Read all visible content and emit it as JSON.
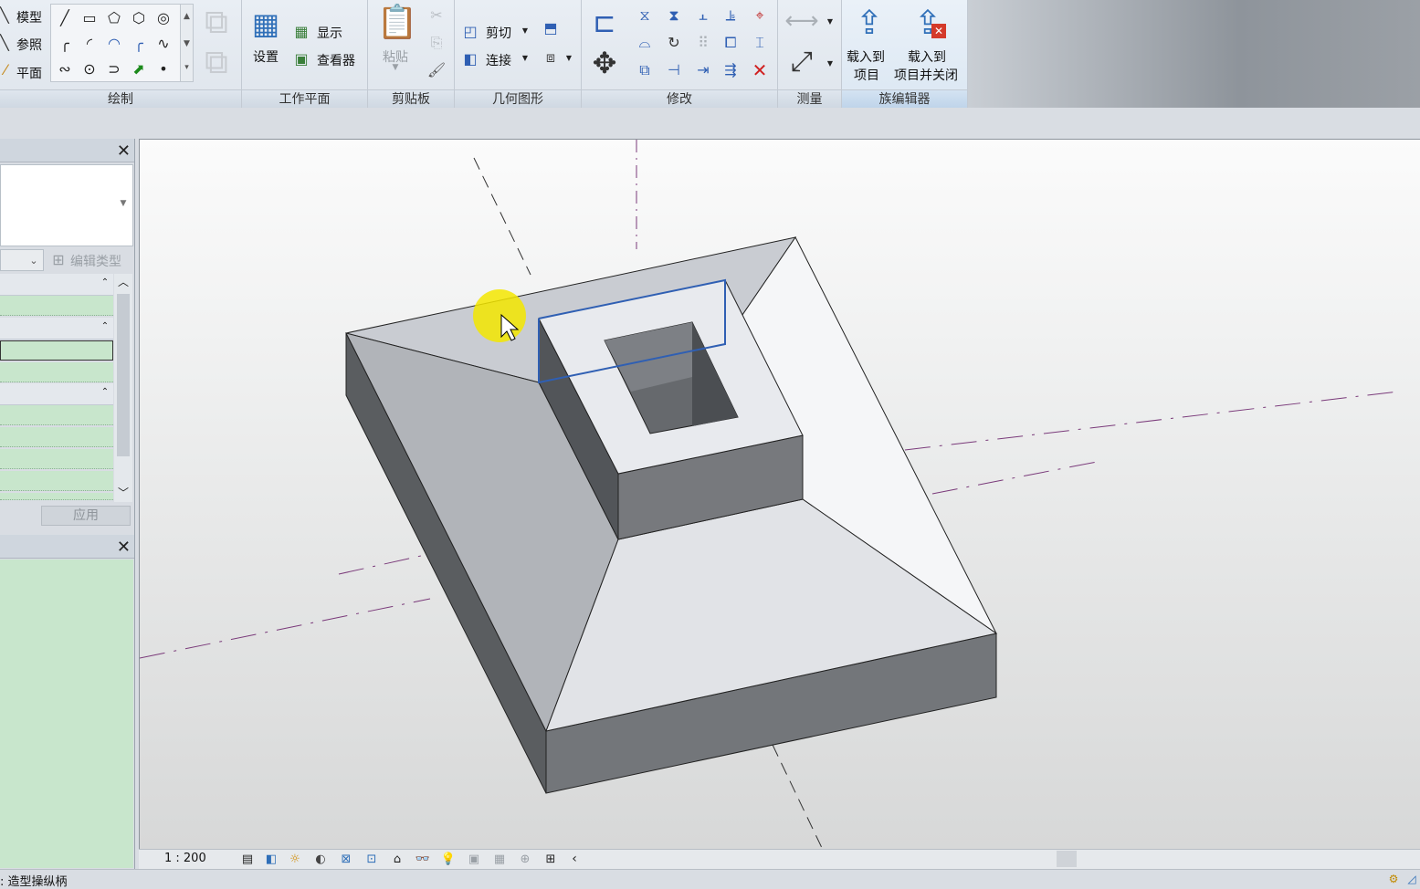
{
  "ribbon": {
    "draw": {
      "items": [
        "模型",
        "参照",
        "平面"
      ],
      "title": "绘制"
    },
    "workplane": {
      "set_label": "设置",
      "show_label": "显示",
      "viewer_label": "查看器",
      "title": "工作平面"
    },
    "clipboard": {
      "paste_label": "粘贴",
      "title": "剪贴板"
    },
    "geometry": {
      "cut_label": "剪切",
      "join_label": "连接",
      "title": "几何图形"
    },
    "modify": {
      "title": "修改"
    },
    "measure": {
      "title": "测量"
    },
    "family_editor": {
      "load_label_1": "载入到",
      "load_label_2": "项目",
      "load_close_label_1": "载入到",
      "load_close_label_2": "项目并关闭",
      "title": "族编辑器"
    }
  },
  "properties": {
    "edit_type_label": "编辑类型",
    "apply_label": "应用"
  },
  "view_control_bar": {
    "scale": "1 : 200"
  },
  "status": {
    "text": ": 造型操纵柄"
  },
  "colors": {
    "accent_blue": "#2f5fb3",
    "highlight_yellow": "#f3e600",
    "prop_green": "#c8e6cc"
  }
}
